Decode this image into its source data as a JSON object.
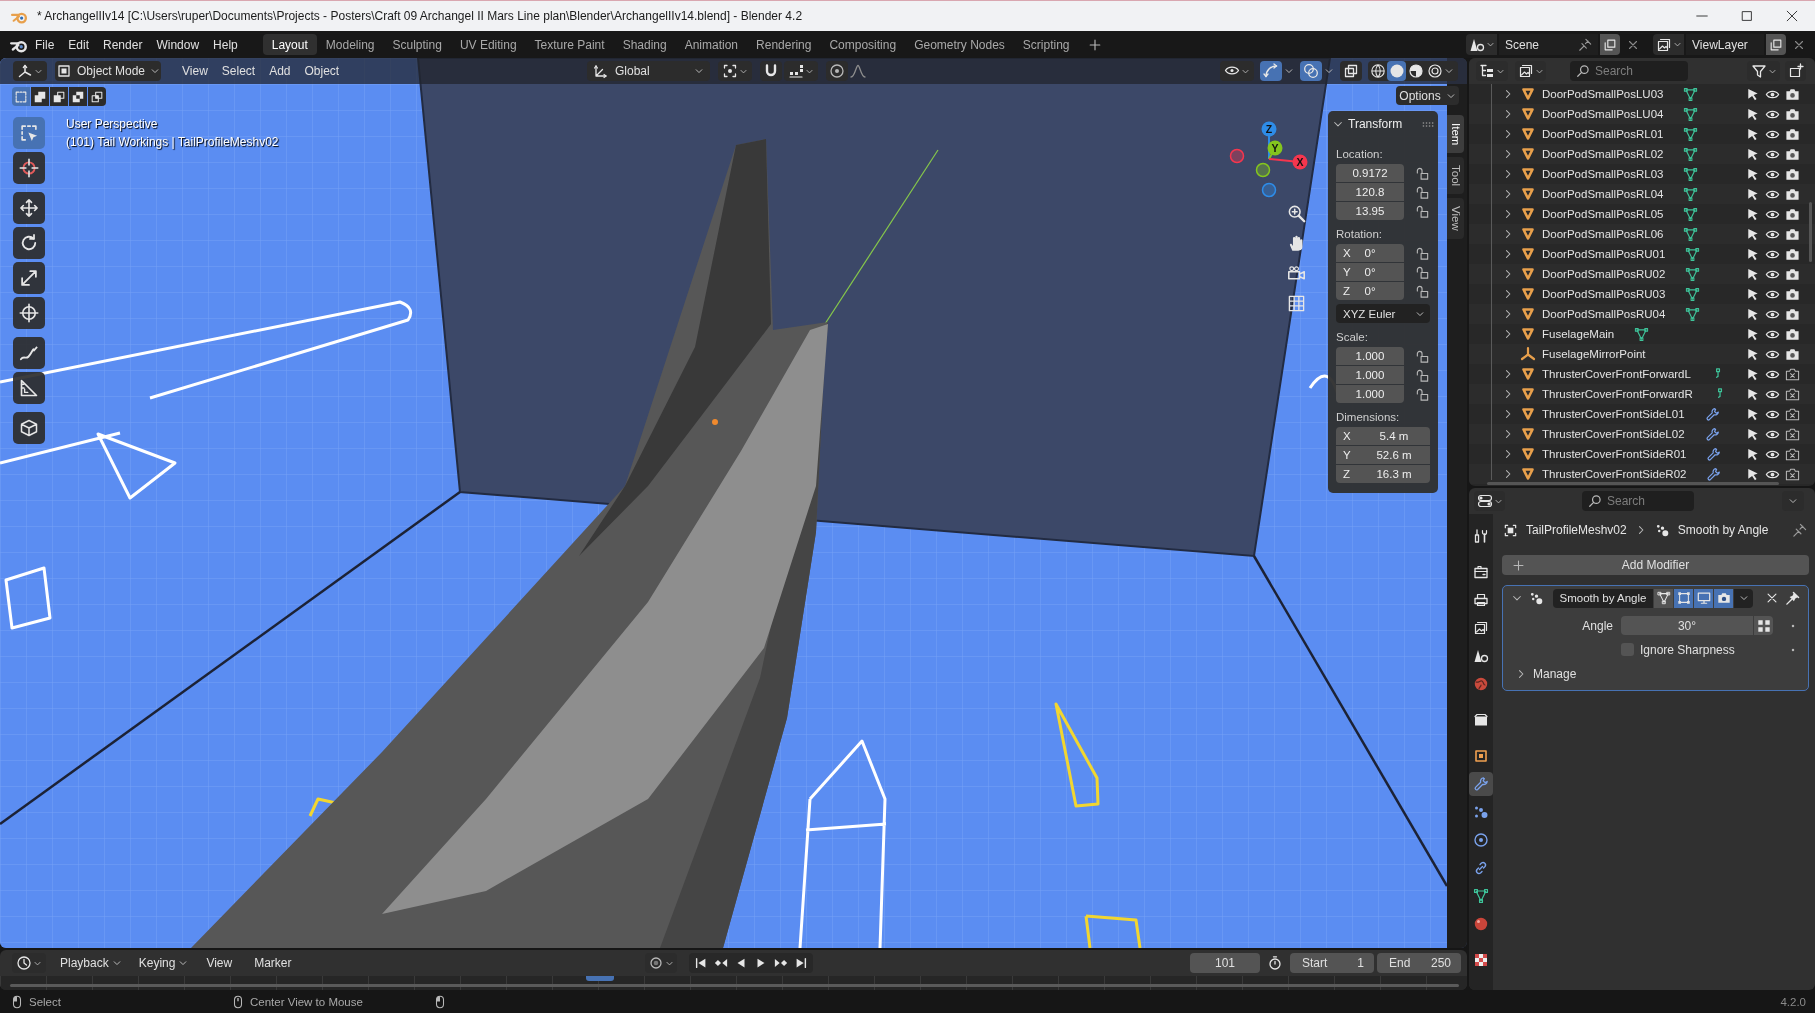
{
  "window": {
    "title": "* ArchangelIIv14 [C:\\Users\\ruper\\Documents\\Projects - Posters\\Craft 09 Archangel II Mars Line plan\\Blender\\ArchangelIIv14.blend] - Blender 4.2"
  },
  "menu": [
    "File",
    "Edit",
    "Render",
    "Window",
    "Help"
  ],
  "workspaces": [
    {
      "label": "Layout",
      "selected": true
    },
    {
      "label": "Modeling",
      "selected": false
    },
    {
      "label": "Sculpting",
      "selected": false
    },
    {
      "label": "UV Editing",
      "selected": false
    },
    {
      "label": "Texture Paint",
      "selected": false
    },
    {
      "label": "Shading",
      "selected": false
    },
    {
      "label": "Animation",
      "selected": false
    },
    {
      "label": "Rendering",
      "selected": false
    },
    {
      "label": "Compositing",
      "selected": false
    },
    {
      "label": "Geometry Nodes",
      "selected": false
    },
    {
      "label": "Scripting",
      "selected": false
    }
  ],
  "scene": {
    "name": "Scene"
  },
  "view_layer": {
    "name": "ViewLayer"
  },
  "viewport": {
    "mode": "Object Mode",
    "menus": [
      "View",
      "Select",
      "Add",
      "Object"
    ],
    "orientation": "Global",
    "snapping": {
      "on": false
    },
    "proportional_editing": {
      "on": false
    },
    "gizmos": {
      "on": true
    },
    "overlays": {
      "on": true
    },
    "xray": {
      "on": false
    },
    "shading_modes": [
      {
        "kind": "wireframe",
        "selected": false
      },
      {
        "kind": "solid",
        "selected": true
      },
      {
        "kind": "material",
        "selected": false
      },
      {
        "kind": "rendered",
        "selected": false
      }
    ],
    "select_modes": [
      {
        "kind": "set",
        "selected": true
      },
      {
        "kind": "extend",
        "selected": false
      },
      {
        "kind": "subtract",
        "selected": false
      },
      {
        "kind": "difference",
        "selected": false
      },
      {
        "kind": "intersect",
        "selected": false
      }
    ],
    "options": "Options",
    "overlay_lines": [
      "User Perspective",
      "(101) Tail Workings | TailProfileMeshv02"
    ],
    "tools": [
      {
        "kind": "select_box",
        "selected": true
      },
      {
        "kind": "cursor",
        "selected": false
      },
      {
        "kind": "move",
        "selected": false
      },
      {
        "kind": "rotate",
        "selected": false
      },
      {
        "kind": "scale",
        "selected": false
      },
      {
        "kind": "transform",
        "selected": false
      },
      {
        "kind": "annotate",
        "selected": false
      },
      {
        "kind": "measure",
        "selected": false
      },
      {
        "kind": "add_cube",
        "selected": false
      }
    ],
    "gizmo_axes": [
      {
        "label": "Z",
        "color": "#2e8ce8"
      },
      {
        "label": "Y",
        "color": "#84c51e"
      },
      {
        "label": "X",
        "color": "#f5364e"
      }
    ],
    "sidebar_tabs": [
      {
        "label": "Item",
        "selected": true
      },
      {
        "label": "Tool",
        "selected": false
      },
      {
        "label": "View",
        "selected": false
      }
    ],
    "transform": {
      "title": "Transform",
      "groups": [
        {
          "label": "Location:",
          "fields": [
            {
              "value": "0.9172",
              "locked": false
            },
            {
              "value": "120.8",
              "locked": false
            },
            {
              "value": "13.95",
              "locked": false
            }
          ]
        },
        {
          "label": "Rotation:",
          "fields": [
            {
              "axis": "X",
              "value": "0°",
              "locked": false
            },
            {
              "axis": "Y",
              "value": "0°",
              "locked": false
            },
            {
              "axis": "Z",
              "value": "0°",
              "locked": false
            }
          ],
          "mode": "XYZ Euler"
        },
        {
          "label": "Scale:",
          "fields": [
            {
              "value": "1.000",
              "locked": false
            },
            {
              "value": "1.000",
              "locked": false
            },
            {
              "value": "1.000",
              "locked": false
            }
          ]
        },
        {
          "label": "Dimensions:",
          "fields": [
            {
              "axis": "X",
              "value": "5.4 m"
            },
            {
              "axis": "Y",
              "value": "52.6 m"
            },
            {
              "axis": "Z",
              "value": "16.3 m"
            }
          ]
        }
      ]
    }
  },
  "outliner": {
    "search_placeholder": "Search",
    "items": [
      {
        "name": "DoorPodSmallPosLU03",
        "kind": "mesh",
        "expanded": false,
        "data": {
          "kind": "mesh"
        },
        "selectable": true,
        "visible": true,
        "renderable": true
      },
      {
        "name": "DoorPodSmallPosLU04",
        "kind": "mesh",
        "expanded": false,
        "data": {
          "kind": "mesh"
        },
        "selectable": true,
        "visible": true,
        "renderable": true
      },
      {
        "name": "DoorPodSmallPosRL01",
        "kind": "mesh",
        "expanded": false,
        "data": {
          "kind": "mesh"
        },
        "selectable": true,
        "visible": true,
        "renderable": true
      },
      {
        "name": "DoorPodSmallPosRL02",
        "kind": "mesh",
        "expanded": false,
        "data": {
          "kind": "mesh"
        },
        "selectable": true,
        "visible": true,
        "renderable": true
      },
      {
        "name": "DoorPodSmallPosRL03",
        "kind": "mesh",
        "expanded": false,
        "data": {
          "kind": "mesh"
        },
        "selectable": true,
        "visible": true,
        "renderable": true
      },
      {
        "name": "DoorPodSmallPosRL04",
        "kind": "mesh",
        "expanded": false,
        "data": {
          "kind": "mesh"
        },
        "selectable": true,
        "visible": true,
        "renderable": true
      },
      {
        "name": "DoorPodSmallPosRL05",
        "kind": "mesh",
        "expanded": false,
        "data": {
          "kind": "mesh"
        },
        "selectable": true,
        "visible": true,
        "renderable": true
      },
      {
        "name": "DoorPodSmallPosRL06",
        "kind": "mesh",
        "expanded": false,
        "data": {
          "kind": "mesh"
        },
        "selectable": true,
        "visible": true,
        "renderable": true
      },
      {
        "name": "DoorPodSmallPosRU01",
        "kind": "mesh",
        "expanded": false,
        "data": {
          "kind": "mesh"
        },
        "selectable": true,
        "visible": true,
        "renderable": true
      },
      {
        "name": "DoorPodSmallPosRU02",
        "kind": "mesh",
        "expanded": false,
        "data": {
          "kind": "mesh"
        },
        "selectable": true,
        "visible": true,
        "renderable": true
      },
      {
        "name": "DoorPodSmallPosRU03",
        "kind": "mesh",
        "expanded": false,
        "data": {
          "kind": "mesh"
        },
        "selectable": true,
        "visible": true,
        "renderable": true
      },
      {
        "name": "DoorPodSmallPosRU04",
        "kind": "mesh",
        "expanded": false,
        "data": {
          "kind": "mesh"
        },
        "selectable": true,
        "visible": true,
        "renderable": true
      },
      {
        "name": "FuselageMain",
        "kind": "mesh",
        "expanded": false,
        "data": {
          "kind": "mesh"
        },
        "selectable": true,
        "visible": true,
        "renderable": true
      },
      {
        "name": "FuselageMirrorPoint",
        "kind": "empty",
        "selectable": true,
        "visible": true,
        "renderable": true
      },
      {
        "name": "ThrusterCoverFrontForwardL",
        "kind": "mesh",
        "expanded": false,
        "data": {
          "kind": "hook"
        },
        "selectable": true,
        "visible": true,
        "renderable": false
      },
      {
        "name": "ThrusterCoverFrontForwardR",
        "kind": "mesh",
        "expanded": false,
        "data": {
          "kind": "hook"
        },
        "selectable": true,
        "visible": true,
        "renderable": false
      },
      {
        "name": "ThrusterCoverFrontSideL01",
        "kind": "mesh",
        "expanded": false,
        "data": {
          "kind": "modifier"
        },
        "selectable": true,
        "visible": true,
        "renderable": false
      },
      {
        "name": "ThrusterCoverFrontSideL02",
        "kind": "mesh",
        "expanded": false,
        "data": {
          "kind": "modifier"
        },
        "selectable": true,
        "visible": true,
        "renderable": false
      },
      {
        "name": "ThrusterCoverFrontSideR01",
        "kind": "mesh",
        "expanded": false,
        "data": {
          "kind": "modifier"
        },
        "selectable": true,
        "visible": true,
        "renderable": false
      },
      {
        "name": "ThrusterCoverFrontSideR02",
        "kind": "mesh",
        "expanded": false,
        "data": {
          "kind": "modifier"
        },
        "selectable": true,
        "visible": true,
        "renderable": false
      }
    ]
  },
  "properties": {
    "search_placeholder": "Search",
    "tab_groups": [
      [
        {
          "kind": "tool",
          "selected": false
        }
      ],
      [
        {
          "kind": "render",
          "selected": false
        },
        {
          "kind": "output",
          "selected": false
        },
        {
          "kind": "view_layer",
          "selected": false
        },
        {
          "kind": "scene",
          "selected": false
        },
        {
          "kind": "world",
          "selected": false
        }
      ],
      [
        {
          "kind": "collection",
          "selected": false
        }
      ],
      [
        {
          "kind": "object",
          "selected": false
        },
        {
          "kind": "modifiers",
          "selected": true
        },
        {
          "kind": "particles",
          "selected": false
        },
        {
          "kind": "physics",
          "selected": false
        },
        {
          "kind": "constraints",
          "selected": false
        },
        {
          "kind": "data",
          "selected": false
        },
        {
          "kind": "material",
          "selected": false
        }
      ],
      [
        {
          "kind": "texture",
          "selected": false
        }
      ]
    ],
    "breadcrumb": {
      "object": "TailProfileMeshv02",
      "modifier": "Smooth by Angle"
    },
    "add_modifier": "Add Modifier",
    "modifier": {
      "name": "Smooth by Angle",
      "expanded": true,
      "toggles": [
        {
          "kind": "on_cage",
          "on": false
        },
        {
          "kind": "edit_mode",
          "on": true
        },
        {
          "kind": "viewport",
          "on": true
        },
        {
          "kind": "render",
          "on": true
        }
      ],
      "inputs": [
        {
          "kind": "number",
          "label": "Angle",
          "value": "30°"
        },
        {
          "kind": "checkbox",
          "label": "Ignore Sharpness",
          "checked": false
        }
      ],
      "subpanels": [
        {
          "label": "Manage",
          "expanded": false
        }
      ]
    }
  },
  "timeline": {
    "menus": [
      {
        "label": "Playback",
        "kind": "dropdown"
      },
      {
        "label": "Keying",
        "kind": "dropdown"
      },
      {
        "label": "View",
        "kind": "menu"
      },
      {
        "label": "Marker",
        "kind": "menu"
      }
    ],
    "auto_keying": {
      "on": false
    },
    "current_frame": "101",
    "start": {
      "label": "Start",
      "value": "1"
    },
    "end": {
      "label": "End",
      "value": "250"
    }
  },
  "status_bar": {
    "hints": [
      "Select",
      "Center View to Mouse"
    ],
    "version": "4.2.0"
  }
}
